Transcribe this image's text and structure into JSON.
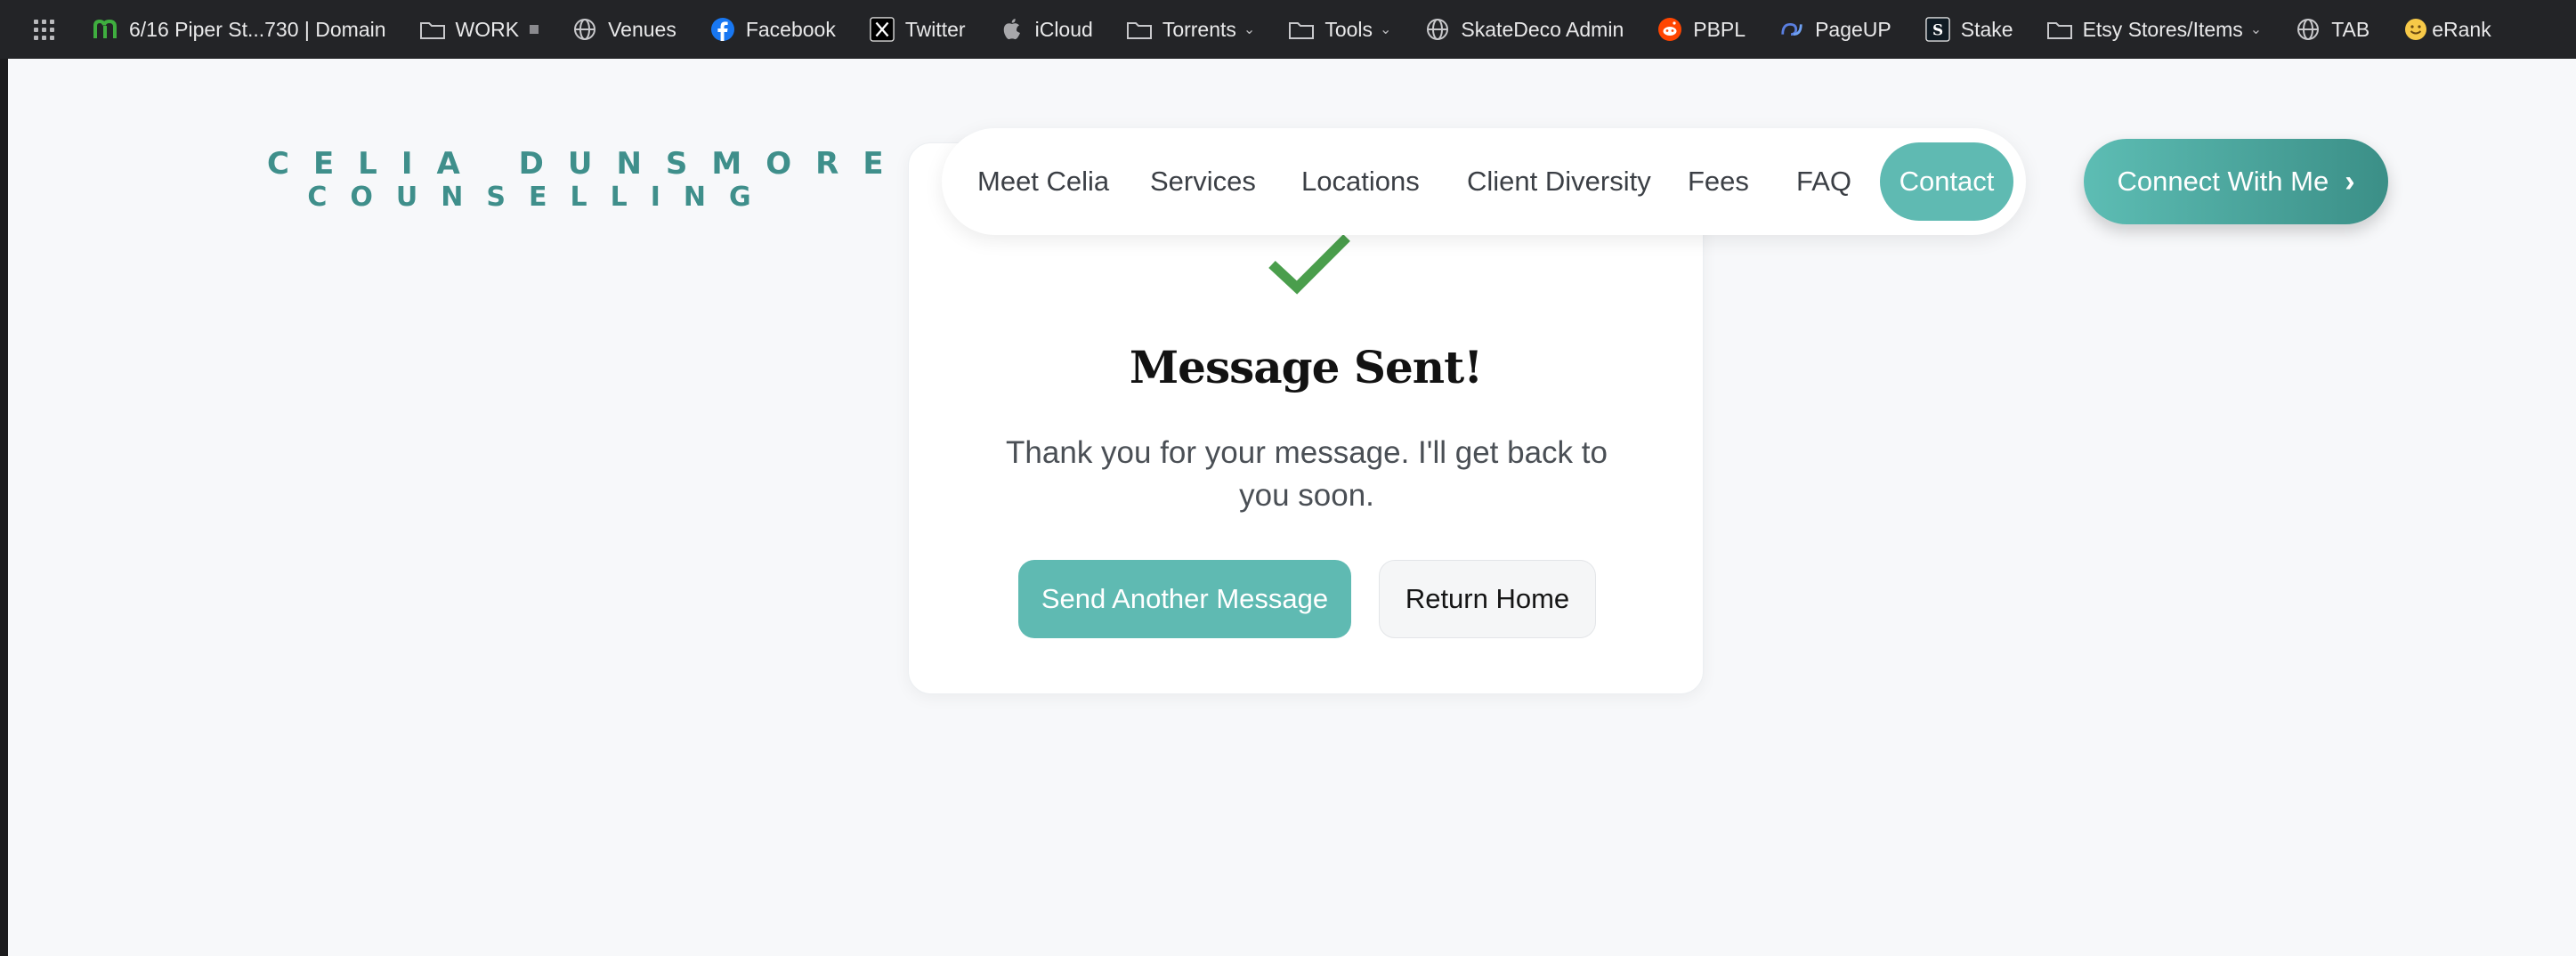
{
  "bookmarks": [
    {
      "label": "6/16 Piper St...730 | Domain",
      "icon": "domain-m-icon"
    },
    {
      "label": "WORK",
      "icon": "folder-icon"
    },
    {
      "label": "Venues",
      "icon": "globe-icon"
    },
    {
      "label": "Facebook",
      "icon": "facebook-icon"
    },
    {
      "label": "Twitter",
      "icon": "x-icon"
    },
    {
      "label": "iCloud",
      "icon": "apple-icon"
    },
    {
      "label": "Torrents",
      "icon": "folder-icon"
    },
    {
      "label": "Tools",
      "icon": "folder-icon"
    },
    {
      "label": "SkateDeco Admin",
      "icon": "globe-icon"
    },
    {
      "label": "PBPL",
      "icon": "reddit-icon"
    },
    {
      "label": "PageUP",
      "icon": "pageup-icon"
    },
    {
      "label": "Stake",
      "icon": "stake-icon"
    },
    {
      "label": "Etsy Stores/Items",
      "icon": "folder-icon"
    },
    {
      "label": "TAB",
      "icon": "globe-icon"
    },
    {
      "label": "eRank",
      "icon": "smiley-icon"
    }
  ],
  "logo": {
    "line1": "CELIA DUNSMORE",
    "line2": "COUNSELLING"
  },
  "nav": {
    "items": [
      "Meet Celia",
      "Services",
      "Locations",
      "Client Diversity",
      "Fees",
      "FAQ"
    ],
    "active": "Contact"
  },
  "cta": {
    "label": "Connect With Me",
    "arrow": "›"
  },
  "card": {
    "title": "Message Sent!",
    "message": "Thank you for your message. I'll get back to you soon.",
    "primary_button": "Send Another Message",
    "secondary_button": "Return Home"
  },
  "colors": {
    "accent": "#5fbab2",
    "logo": "#3f8f8b",
    "check": "#4a9e4c"
  }
}
